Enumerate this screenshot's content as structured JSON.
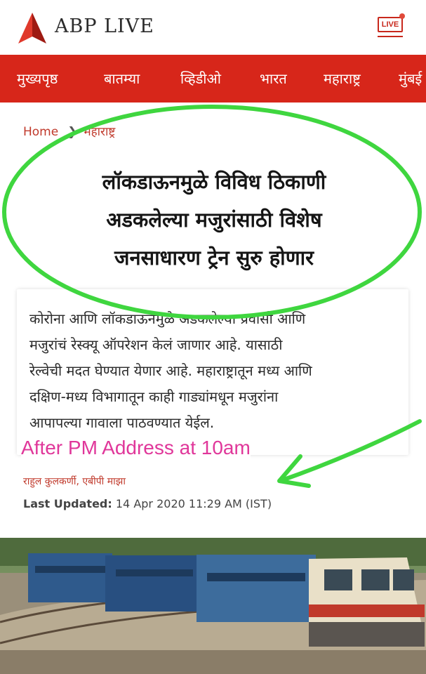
{
  "header": {
    "brand": "ABP LIVE",
    "live_label": "LIVE",
    "icons": {
      "logo": "abp-triangle-logo",
      "live": "live-tv-icon"
    }
  },
  "nav": {
    "items": [
      "मुख्यपृष्ठ",
      "बातम्या",
      "व्हिडीओ",
      "भारत",
      "महाराष्ट्र",
      "मुंबई"
    ]
  },
  "breadcrumb": {
    "home": "Home",
    "current": "महाराष्ट्र"
  },
  "article": {
    "headline_lines": [
      "लॉकडाऊनमुळे विविध ठिकाणी",
      "अडकलेल्या मजुरांसाठी विशेष",
      "जनसाधारण ट्रेन सुरु होणार"
    ],
    "summary_lines": [
      "कोरोना आणि लॉकडाऊनमुळे अडकलेल्या प्रवासी आणि",
      "मजुरांचं रेस्क्यू ऑपरेशन केलं जाणार आहे. यासाठी",
      "रेल्वेची मदत घेण्यात येणार आहे. महाराष्ट्रातून मध्य आणि",
      "दक्षिण-मध्य विभागातून काही गाड्यांमधून मजुरांना",
      "आपापल्या गावाला पाठवण्यात येईल."
    ],
    "author": "राहुल कुलकर्णी, एबीपी माझा",
    "updated_label": "Last Updated:",
    "updated_value": "14 Apr 2020 11:29 AM (IST)"
  },
  "annotation": {
    "text": "After PM Address at 10am"
  },
  "colors": {
    "nav_bg": "#d7261a",
    "brand_red": "#c8281c",
    "annotation_green": "#3fd63f",
    "annotation_pink": "#e0379a"
  }
}
